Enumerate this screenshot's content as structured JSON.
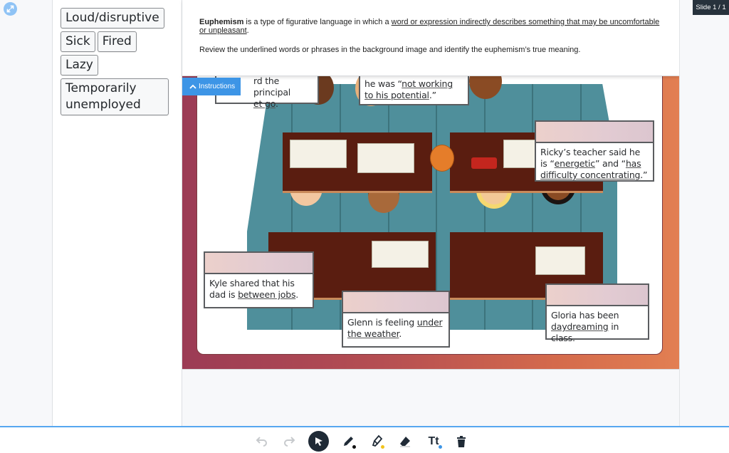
{
  "app": {
    "slide_indicator": "Slide 1 / 1",
    "expand_icon": "expand-arrows-icon"
  },
  "word_bank": {
    "chips": [
      {
        "label": "Loud/disruptive"
      },
      {
        "label": "Sick"
      },
      {
        "label": "Fired"
      },
      {
        "label": "Lazy"
      },
      {
        "label": "Temporarily unemployed"
      }
    ]
  },
  "instructions": {
    "tab_label": "Instructions",
    "tab_icon": "chevron-up-icon",
    "definition_term": "Euphemism",
    "definition_middle": " is a type of figurative language in which a ",
    "definition_underlined": "word or expression indirectly describes something that may be uncomfortable or unpleasant",
    "definition_end": ".",
    "task": "Review the underlined words or phrases in the background image and identify the euphemism’s true meaning."
  },
  "prompts": [
    {
      "id": "principal",
      "before": "",
      "partial_line1": "rd the principal",
      "partial_line2_u": "et go",
      "partial_line2_after": "."
    },
    {
      "id": "potential",
      "before": "he was “",
      "underlined": "not working to his potential",
      "after": ".”"
    },
    {
      "id": "ricky",
      "before": "Ricky’s teacher said he is “",
      "underlined_1": "energetic",
      "middle": "” and “",
      "underlined_2": "has difficulty concentrating",
      "after": ".”"
    },
    {
      "id": "kyle",
      "before": "Kyle shared that his dad is ",
      "underlined": "between jobs",
      "after": "."
    },
    {
      "id": "glenn",
      "before": "Glenn is feeling ",
      "underlined": "under the weather",
      "after": "."
    },
    {
      "id": "gloria",
      "before": "Gloria has been ",
      "underlined": "daydreaming",
      "after": " in class."
    }
  ],
  "toolbar": {
    "tools": [
      {
        "name": "undo",
        "icon": "undo-icon",
        "enabled": false
      },
      {
        "name": "redo",
        "icon": "redo-icon",
        "enabled": false
      },
      {
        "name": "select",
        "icon": "cursor-arrow-icon",
        "active": true
      },
      {
        "name": "pen",
        "icon": "pen-icon",
        "color": "#111111"
      },
      {
        "name": "highlighter",
        "icon": "highlighter-icon",
        "color": "#f2c31b"
      },
      {
        "name": "eraser",
        "icon": "eraser-icon"
      },
      {
        "name": "text",
        "icon": "text-tool-icon",
        "label": "Tt",
        "color": "#3d95e6"
      },
      {
        "name": "delete",
        "icon": "trash-icon"
      }
    ]
  },
  "colors": {
    "accent": "#3d95e6",
    "toolbar_active": "#1f2a36",
    "stage_gradient_start": "#9b3b55",
    "stage_gradient_end": "#e27f52",
    "drop_zone": "#e6cdd0"
  }
}
